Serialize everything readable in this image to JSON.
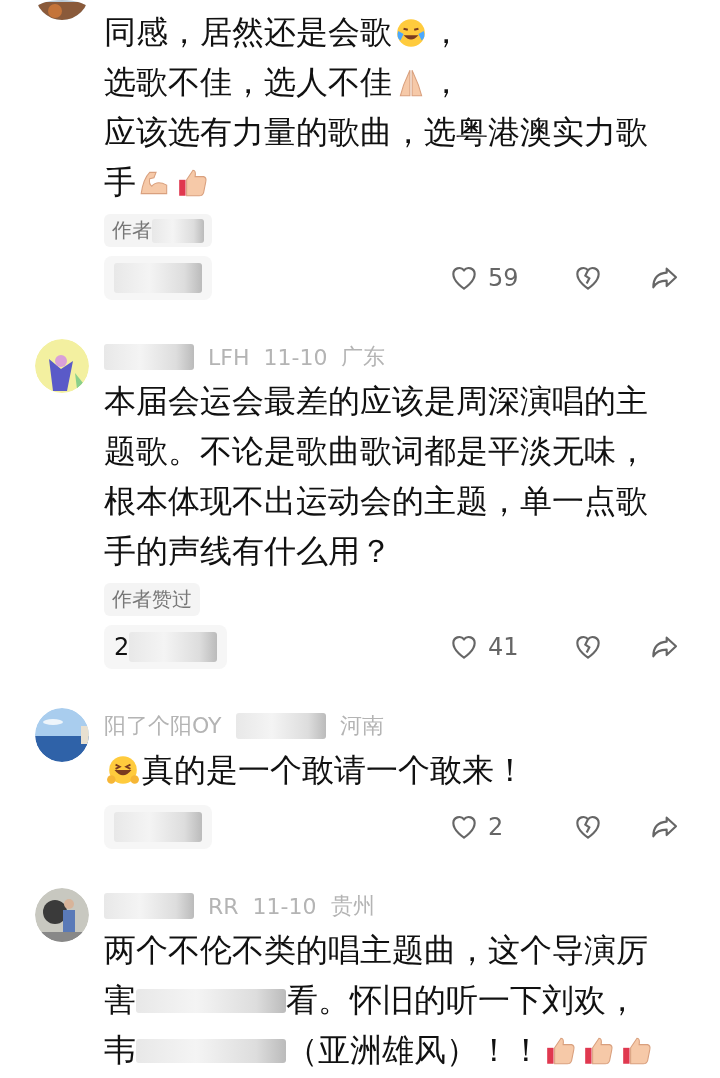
{
  "comments": [
    {
      "lines": [
        [
          {
            "kind": "text",
            "text": "同感，居然还是会歌"
          },
          {
            "kind": "emoji-laugh-cry"
          },
          {
            "kind": "text",
            "text": "，"
          }
        ],
        [
          {
            "kind": "text",
            "text": "选歌不佳，选人不佳"
          },
          {
            "kind": "emoji-pray"
          },
          {
            "kind": "text",
            "text": "，"
          }
        ],
        [
          {
            "kind": "text",
            "text": "应该选有力量的歌曲，选粤港澳实力歌"
          }
        ],
        [
          {
            "kind": "text",
            "text": "手"
          },
          {
            "kind": "emoji-muscle"
          },
          {
            "kind": "emoji-thumbs"
          }
        ]
      ],
      "tag": [
        {
          "kind": "text",
          "text": "作者"
        },
        {
          "kind": "redaction"
        }
      ],
      "reply": [
        {
          "kind": "redaction"
        }
      ],
      "likes": "59"
    },
    {
      "meta": [
        {
          "kind": "redaction"
        },
        {
          "kind": "text",
          "text": "LFH"
        },
        {
          "kind": "text",
          "text": "11-10"
        },
        {
          "kind": "text",
          "text": "广东"
        }
      ],
      "lines": [
        [
          {
            "kind": "text",
            "text": "本届会运会最差的应该是周深演唱的主"
          }
        ],
        [
          {
            "kind": "text",
            "text": "题歌。不论是歌曲歌词都是平淡无味，"
          }
        ],
        [
          {
            "kind": "text",
            "text": "根本体现不出运动会的主题，单一点歌"
          }
        ],
        [
          {
            "kind": "text",
            "text": "手的声线有什么用？"
          }
        ]
      ],
      "tag": [
        {
          "kind": "text",
          "text": "作者赞过"
        }
      ],
      "reply": [
        {
          "kind": "text",
          "text": "2"
        },
        {
          "kind": "redaction"
        }
      ],
      "likes": "41"
    },
    {
      "meta": [
        {
          "kind": "text",
          "text": "阳了个阳OY"
        },
        {
          "kind": "redaction"
        },
        {
          "kind": "text",
          "text": "河南"
        }
      ],
      "lines": [
        [
          {
            "kind": "emoji-grin-hands"
          },
          {
            "kind": "text",
            "text": "真的是一个敢请一个敢来！"
          }
        ]
      ],
      "reply": [
        {
          "kind": "redaction"
        }
      ],
      "likes": "2"
    },
    {
      "meta": [
        {
          "kind": "redaction"
        },
        {
          "kind": "text",
          "text": "RR"
        },
        {
          "kind": "text",
          "text": "11-10"
        },
        {
          "kind": "text",
          "text": "贵州"
        }
      ],
      "lines": [
        [
          {
            "kind": "text",
            "text": "两个不伦不类的唱主题曲，这个导演厉"
          }
        ],
        [
          {
            "kind": "text",
            "text": "害"
          },
          {
            "kind": "redaction"
          },
          {
            "kind": "text",
            "text": "看。怀旧的听一下刘欢，"
          }
        ],
        [
          {
            "kind": "text",
            "text": "韦"
          },
          {
            "kind": "redaction"
          },
          {
            "kind": "text",
            "text": "（亚洲雄风）！！"
          },
          {
            "kind": "emoji-thumbs"
          },
          {
            "kind": "emoji-thumbs"
          },
          {
            "kind": "emoji-thumbs"
          }
        ]
      ]
    }
  ]
}
